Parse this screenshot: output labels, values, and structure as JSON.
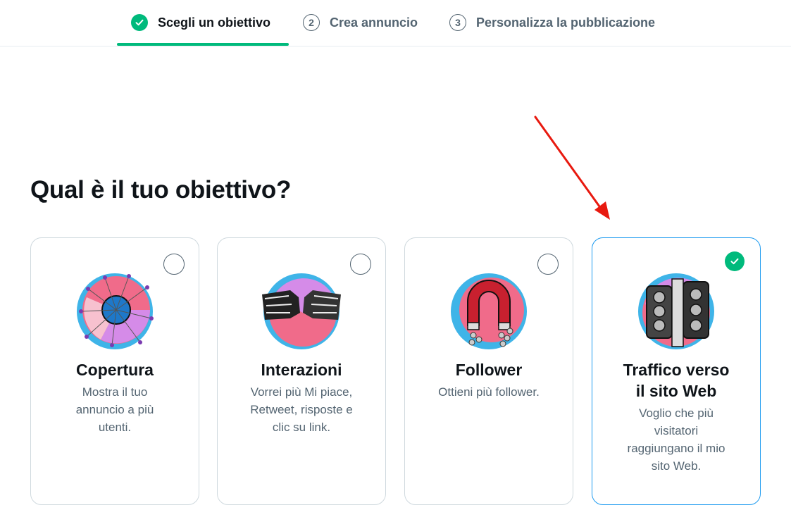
{
  "stepper": {
    "steps": [
      {
        "number": "",
        "label": "Scegli un obiettivo",
        "status": "completed"
      },
      {
        "number": "2",
        "label": "Crea annuncio",
        "status": "upcoming"
      },
      {
        "number": "3",
        "label": "Personalizza la pubblicazione",
        "status": "upcoming"
      }
    ]
  },
  "page": {
    "heading": "Qual è il tuo obiettivo?"
  },
  "cards": [
    {
      "title_line1": "Copertura",
      "title_line2": "",
      "description": [
        "Mostra il tuo",
        "annuncio a più",
        "utenti."
      ],
      "selected": false,
      "icon": "reach-target-icon"
    },
    {
      "title_line1": "Interazioni",
      "title_line2": "",
      "description": [
        "Vorrei più Mi piace,",
        "Retweet, risposte e",
        "clic su link."
      ],
      "selected": false,
      "icon": "fist-bump-icon"
    },
    {
      "title_line1": "Follower",
      "title_line2": "",
      "description": [
        "Ottieni più follower."
      ],
      "selected": false,
      "icon": "magnet-icon"
    },
    {
      "title_line1": "Traffico verso",
      "title_line2": "il sito Web",
      "description": [
        "Voglio che più",
        "visitatori",
        "raggiungano il mio",
        "sito Web."
      ],
      "selected": true,
      "icon": "traffic-light-icon"
    }
  ],
  "colors": {
    "accent_green": "#00ba7c",
    "selected_border": "#1d9bf0",
    "annotation_arrow": "#e8190f"
  }
}
